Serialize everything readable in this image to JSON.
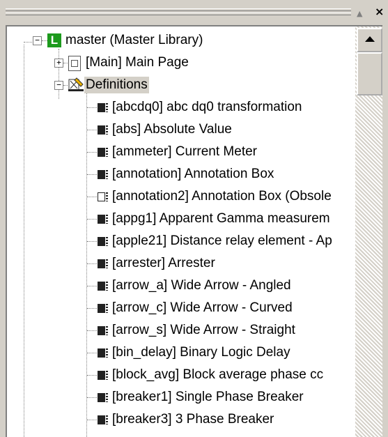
{
  "window": {
    "up_glyph": "▲",
    "close_glyph": "×"
  },
  "tree": {
    "root": {
      "label": "master (Master Library)",
      "icon_letter": "L",
      "expander": "−"
    },
    "main_page": {
      "label": "[Main] Main Page",
      "expander": "+"
    },
    "definitions": {
      "label": "Definitions",
      "expander": "−",
      "selected": true
    },
    "items": [
      {
        "label": "[abcdq0] abc dq0 transformation",
        "hollow": false
      },
      {
        "label": "[abs] Absolute Value",
        "hollow": false
      },
      {
        "label": "[ammeter] Current Meter",
        "hollow": false
      },
      {
        "label": "[annotation] Annotation Box",
        "hollow": false
      },
      {
        "label": "[annotation2] Annotation Box (Obsole",
        "hollow": true
      },
      {
        "label": "[appg1] Apparent Gamma measurem",
        "hollow": false
      },
      {
        "label": "[apple21] Distance relay element - Ap",
        "hollow": false
      },
      {
        "label": "[arrester] Arrester",
        "hollow": false
      },
      {
        "label": "[arrow_a] Wide Arrow - Angled",
        "hollow": false
      },
      {
        "label": "[arrow_c] Wide Arrow - Curved",
        "hollow": false
      },
      {
        "label": "[arrow_s] Wide Arrow - Straight",
        "hollow": false
      },
      {
        "label": "[bin_delay] Binary Logic Delay",
        "hollow": false
      },
      {
        "label": "[block_avg] Block average phase cc",
        "hollow": false
      },
      {
        "label": "[breaker1] Single Phase Breaker",
        "hollow": false
      },
      {
        "label": "[breaker3] 3 Phase Breaker",
        "hollow": false
      }
    ]
  }
}
